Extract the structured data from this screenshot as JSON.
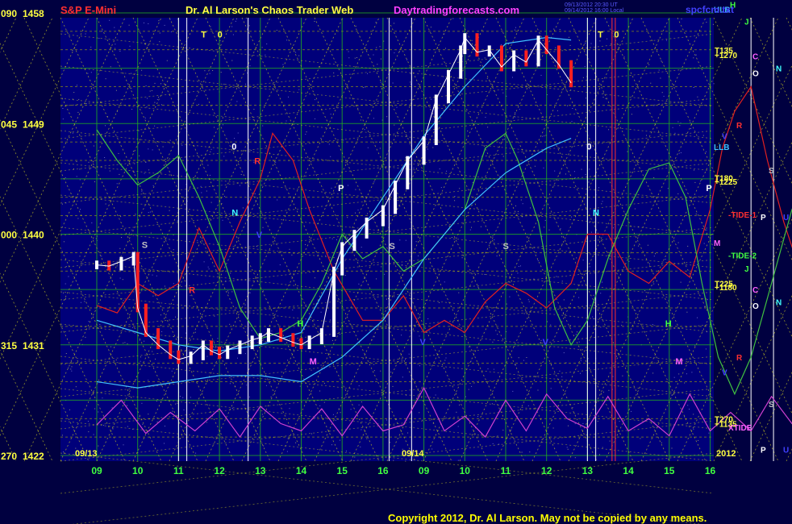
{
  "header": {
    "instrument": "S&P E-Mini",
    "title": "Dr. Al Larson's Chaos Trader Web",
    "site": "Daytradingforecasts.com",
    "file": "spcfcm.txt",
    "stamp_line1": "09/13/2012 20:30 UT",
    "stamp_line2": "09/14/2012 16:00 Local"
  },
  "copyright": "Copyright 2012, Dr. Al Larson. May not be copied by any means.",
  "colors": {
    "background": "#000040",
    "plot_background": "#00007a",
    "grid_major": "#22aa22",
    "grid_minor": "#aaaa00",
    "price_up": "#ffffff",
    "price_down": "#ff2020",
    "tide1": "#e02020",
    "tide2": "#40c040",
    "xtide": "#d040d0",
    "band": "#40c0ff",
    "vline": "#ffffff",
    "redline": "#ff3030"
  },
  "chart_data": {
    "type": "line",
    "title": "S&P E-Mini",
    "y_labels": [
      {
        "key": "090",
        "price": "1458"
      },
      {
        "key": "045",
        "price": "1449"
      },
      {
        "key": "000",
        "price": "1440"
      },
      {
        "key": "315",
        "price": "1431"
      },
      {
        "key": "270",
        "price": "1422"
      }
    ],
    "ylim": [
      1422,
      1458
    ],
    "x_ticks": [
      "09",
      "10",
      "11",
      "12",
      "13",
      "14",
      "15",
      "16",
      "09",
      "10",
      "11",
      "12",
      "13",
      "14",
      "15",
      "16"
    ],
    "dates": [
      "09/13",
      "09/14"
    ],
    "year": "2012",
    "price_series": [
      [
        0,
        1437.5
      ],
      [
        0.3,
        1437.4
      ],
      [
        0.6,
        1437.8
      ],
      [
        0.9,
        1438.2
      ],
      [
        1.0,
        1434.0
      ],
      [
        1.2,
        1432.0
      ],
      [
        1.5,
        1431.0
      ],
      [
        1.8,
        1430.2
      ],
      [
        2.0,
        1429.8
      ],
      [
        2.3,
        1430.1
      ],
      [
        2.6,
        1431.0
      ],
      [
        2.8,
        1430.5
      ],
      [
        3.0,
        1430.2
      ],
      [
        3.2,
        1430.6
      ],
      [
        3.5,
        1431.0
      ],
      [
        3.8,
        1431.4
      ],
      [
        4.0,
        1431.6
      ],
      [
        4.2,
        1432.0
      ],
      [
        4.5,
        1431.6
      ],
      [
        4.8,
        1431.2
      ],
      [
        5.0,
        1431.0
      ],
      [
        5.2,
        1431.4
      ],
      [
        5.5,
        1432.0
      ],
      [
        5.8,
        1437.0
      ],
      [
        6.0,
        1439.0
      ],
      [
        6.3,
        1440.0
      ],
      [
        6.6,
        1441.0
      ],
      [
        7.0,
        1442.0
      ],
      [
        7.3,
        1444.0
      ],
      [
        7.6,
        1446.0
      ],
      [
        8.0,
        1447.6
      ],
      [
        8.3,
        1451.0
      ],
      [
        8.6,
        1453.0
      ],
      [
        8.9,
        1455.0
      ],
      [
        9.0,
        1456.0
      ],
      [
        9.3,
        1454.8
      ],
      [
        9.6,
        1455.0
      ],
      [
        9.9,
        1453.6
      ],
      [
        10.2,
        1454.6
      ],
      [
        10.5,
        1454.0
      ],
      [
        10.8,
        1455.8
      ],
      [
        11.0,
        1455.0
      ],
      [
        11.3,
        1453.8
      ],
      [
        11.6,
        1452.3
      ]
    ],
    "series": [
      {
        "name": "TIDE-1",
        "values": [
          [
            0,
            1434.2
          ],
          [
            0.5,
            1433.6
          ],
          [
            1.0,
            1436.0
          ],
          [
            1.5,
            1435.0
          ],
          [
            2.0,
            1436.0
          ],
          [
            2.5,
            1440.5
          ],
          [
            3.0,
            1437.0
          ],
          [
            3.5,
            1441.0
          ],
          [
            4.0,
            1444.5
          ],
          [
            4.3,
            1448.2
          ],
          [
            4.8,
            1446.0
          ],
          [
            5.2,
            1442.0
          ],
          [
            5.8,
            1437.0
          ],
          [
            6.5,
            1433.0
          ],
          [
            7.0,
            1433.0
          ],
          [
            7.5,
            1435.0
          ],
          [
            8.0,
            1432.0
          ],
          [
            8.5,
            1433.0
          ],
          [
            9.0,
            1432.0
          ],
          [
            9.5,
            1434.5
          ],
          [
            10.0,
            1436.0
          ],
          [
            10.5,
            1435.2
          ],
          [
            11.0,
            1434.0
          ],
          [
            11.6,
            1436.0
          ],
          [
            12.0,
            1440.0
          ],
          [
            12.5,
            1440.0
          ],
          [
            13.0,
            1437.0
          ],
          [
            13.5,
            1436.0
          ],
          [
            14.0,
            1437.8
          ],
          [
            14.5,
            1436.5
          ],
          [
            15.0,
            1442.0
          ],
          [
            15.3,
            1447.0
          ],
          [
            15.6,
            1450.0
          ],
          [
            16.0,
            1452.0
          ],
          [
            16.4,
            1446.0
          ],
          [
            16.8,
            1441.0
          ],
          [
            17.2,
            1437.0
          ],
          [
            17.6,
            1435.0
          ],
          [
            18.0,
            1433.0
          ],
          [
            18.4,
            1432.0
          ],
          [
            18.8,
            1433.0
          ],
          [
            19.0,
            1439.0
          ],
          [
            19.2,
            1440.0
          ]
        ]
      },
      {
        "name": "TIDE-2",
        "values": [
          [
            0,
            1448.5
          ],
          [
            0.5,
            1446.0
          ],
          [
            1.0,
            1444.0
          ],
          [
            1.5,
            1445.0
          ],
          [
            2.0,
            1446.4
          ],
          [
            2.5,
            1443.0
          ],
          [
            3.0,
            1439.0
          ],
          [
            3.5,
            1434.0
          ],
          [
            4.0,
            1431.5
          ],
          [
            4.5,
            1432.0
          ],
          [
            5.0,
            1433.0
          ],
          [
            5.5,
            1436.0
          ],
          [
            6.0,
            1440.0
          ],
          [
            6.5,
            1438.0
          ],
          [
            7.0,
            1439.0
          ],
          [
            7.5,
            1437.0
          ],
          [
            8.0,
            1438.0
          ],
          [
            8.5,
            1440.0
          ],
          [
            9.0,
            1442.0
          ],
          [
            9.5,
            1447.0
          ],
          [
            10.0,
            1448.2
          ],
          [
            10.3,
            1446.0
          ],
          [
            10.8,
            1441.0
          ],
          [
            11.2,
            1434.0
          ],
          [
            11.6,
            1431.0
          ],
          [
            12.0,
            1433.0
          ],
          [
            12.5,
            1438.0
          ],
          [
            13.0,
            1442.0
          ],
          [
            13.5,
            1445.3
          ],
          [
            14.0,
            1445.8
          ],
          [
            14.4,
            1443.0
          ],
          [
            14.8,
            1436.0
          ],
          [
            15.2,
            1430.0
          ],
          [
            15.6,
            1427.0
          ],
          [
            16.0,
            1430.0
          ],
          [
            16.5,
            1436.0
          ],
          [
            17.0,
            1442.0
          ],
          [
            17.5,
            1445.4
          ],
          [
            18.0,
            1442.2
          ],
          [
            18.5,
            1441.6
          ],
          [
            19.0,
            1440.2
          ],
          [
            19.2,
            1438.0
          ]
        ]
      },
      {
        "name": "XTIDE",
        "values": [
          [
            0,
            1424.5
          ],
          [
            0.6,
            1426.5
          ],
          [
            1.2,
            1423.8
          ],
          [
            1.8,
            1425.5
          ],
          [
            2.4,
            1424.0
          ],
          [
            3.0,
            1425.8
          ],
          [
            3.5,
            1423.5
          ],
          [
            4.0,
            1426.0
          ],
          [
            4.5,
            1424.6
          ],
          [
            5.0,
            1424.0
          ],
          [
            5.5,
            1425.8
          ],
          [
            6.0,
            1423.6
          ],
          [
            6.5,
            1426.0
          ],
          [
            7.0,
            1424.0
          ],
          [
            7.5,
            1424.5
          ],
          [
            8.0,
            1427.5
          ],
          [
            8.5,
            1424.0
          ],
          [
            9.0,
            1425.2
          ],
          [
            9.5,
            1423.5
          ],
          [
            10.0,
            1426.5
          ],
          [
            10.5,
            1424.0
          ],
          [
            11.0,
            1427.0
          ],
          [
            11.5,
            1425.0
          ],
          [
            12.0,
            1424.2
          ],
          [
            12.5,
            1426.8
          ],
          [
            13.0,
            1424.0
          ],
          [
            13.5,
            1425.0
          ],
          [
            14.0,
            1423.6
          ],
          [
            14.5,
            1427.0
          ],
          [
            15.0,
            1424.0
          ],
          [
            15.5,
            1425.5
          ],
          [
            16.0,
            1424.0
          ],
          [
            16.5,
            1426.8
          ],
          [
            17.0,
            1424.6
          ],
          [
            17.5,
            1426.0
          ],
          [
            18.0,
            1424.0
          ],
          [
            18.5,
            1425.8
          ],
          [
            19.2,
            1425.0
          ]
        ]
      },
      {
        "name": "Upper Band",
        "values": [
          [
            0,
            1433.0
          ],
          [
            1,
            1432.0
          ],
          [
            2,
            1431.0
          ],
          [
            3,
            1430.5
          ],
          [
            4,
            1431.0
          ],
          [
            5,
            1432.0
          ],
          [
            6,
            1438.0
          ],
          [
            7,
            1443.0
          ],
          [
            8,
            1448.0
          ],
          [
            9,
            1452.0
          ],
          [
            10,
            1455.5
          ],
          [
            11,
            1456.0
          ],
          [
            11.6,
            1455.8
          ]
        ]
      },
      {
        "name": "Lower Band",
        "values": [
          [
            0,
            1428.0
          ],
          [
            1,
            1427.5
          ],
          [
            2,
            1428.0
          ],
          [
            3,
            1428.5
          ],
          [
            4,
            1428.5
          ],
          [
            5,
            1428.0
          ],
          [
            6,
            1430.0
          ],
          [
            7,
            1433.0
          ],
          [
            8,
            1438.0
          ],
          [
            9,
            1442.0
          ],
          [
            10,
            1445.0
          ],
          [
            11,
            1447.0
          ],
          [
            11.6,
            1447.8
          ]
        ]
      }
    ],
    "right_labels": [
      {
        "text": "M",
        "price": 1459.3,
        "color": "#ff60ff"
      },
      {
        "text": "H",
        "price": 1458.7,
        "color": "#40ff40"
      },
      {
        "text": "ULB",
        "price": 1458.3,
        "color": "#40c0ff"
      },
      {
        "text": "J",
        "price": 1457.3,
        "color": "#40ff40"
      },
      {
        "text": "T135",
        "price": 1455.0,
        "color": "#ffff40"
      },
      {
        "text": "+1270",
        "price": 1454.6,
        "color": "#ffff40"
      },
      {
        "text": "C",
        "price": 1454.5,
        "color": "#ff60ff"
      },
      {
        "text": "O",
        "price": 1453.1,
        "color": "#ffffff"
      },
      {
        "text": "N",
        "price": 1453.5,
        "color": "#40ffff"
      },
      {
        "text": "R",
        "price": 1448.9,
        "color": "#ff3030"
      },
      {
        "text": "V",
        "price": 1448.0,
        "color": "#4040ff"
      },
      {
        "text": "LLB",
        "price": 1447.1,
        "color": "#40c0ff"
      },
      {
        "text": "S",
        "price": 1445.2,
        "color": "#c0c0c0"
      },
      {
        "text": "T180",
        "price": 1444.6,
        "color": "#ffff40"
      },
      {
        "text": "+1225",
        "price": 1444.3,
        "color": "#ffff40"
      },
      {
        "text": "-TIDE-1",
        "price": 1441.6,
        "color": "#ff3030"
      },
      {
        "text": "P",
        "price": 1441.4,
        "color": "#ffffff"
      },
      {
        "text": "U",
        "price": 1441.4,
        "color": "#4040ff"
      },
      {
        "text": "M",
        "price": 1439.3,
        "color": "#ff60ff"
      },
      {
        "text": "-TIDE-2",
        "price": 1438.3,
        "color": "#40ff40"
      },
      {
        "text": "J",
        "price": 1437.2,
        "color": "#40ff40"
      },
      {
        "text": "T225",
        "price": 1436.0,
        "color": "#ffff40"
      },
      {
        "text": "+1180",
        "price": 1435.7,
        "color": "#ffff40"
      },
      {
        "text": "C",
        "price": 1435.5,
        "color": "#ff60ff"
      },
      {
        "text": "N",
        "price": 1434.5,
        "color": "#40ffff"
      },
      {
        "text": "O",
        "price": 1434.2,
        "color": "#ffffff"
      },
      {
        "text": "R",
        "price": 1430.0,
        "color": "#ff3030"
      },
      {
        "text": "V",
        "price": 1428.8,
        "color": "#4040ff"
      },
      {
        "text": "S",
        "price": 1426.2,
        "color": "#c0c0c0"
      },
      {
        "text": "T270",
        "price": 1425.0,
        "color": "#ffff40"
      },
      {
        "text": "+1135",
        "price": 1424.6,
        "color": "#ffff40"
      },
      {
        "text": "XTIDE",
        "price": 1424.3,
        "color": "#ff60ff"
      },
      {
        "text": "P",
        "price": 1422.5,
        "color": "#ffffff"
      },
      {
        "text": "U",
        "price": 1422.5,
        "color": "#4040ff"
      }
    ],
    "plot_labels": [
      {
        "text": "T",
        "x": 2.55,
        "price": 1456.0,
        "color": "#ffff40"
      },
      {
        "text": "0",
        "x": 2.95,
        "price": 1456.0,
        "color": "#ffff40"
      },
      {
        "text": "T",
        "x": 12.25,
        "price": 1456.0,
        "color": "#ffff40"
      },
      {
        "text": "0",
        "x": 12.65,
        "price": 1456.0,
        "color": "#ffff40"
      },
      {
        "text": "0",
        "x": 3.3,
        "price": 1446.9,
        "color": "#ffffff"
      },
      {
        "text": "0",
        "x": 11.98,
        "price": 1446.9,
        "color": "#ffffff"
      },
      {
        "text": "P",
        "x": 5.9,
        "price": 1443.5,
        "color": "#ffffff"
      },
      {
        "text": "P",
        "x": 14.9,
        "price": 1443.5,
        "color": "#ffffff"
      },
      {
        "text": "N",
        "x": 3.3,
        "price": 1441.5,
        "color": "#40ffff"
      },
      {
        "text": "N",
        "x": 12.13,
        "price": 1441.5,
        "color": "#40ffff"
      },
      {
        "text": "R",
        "x": 3.85,
        "price": 1445.7,
        "color": "#ff3030"
      },
      {
        "text": "R",
        "x": 2.25,
        "price": 1435.2,
        "color": "#ff3030"
      },
      {
        "text": "V",
        "x": 3.9,
        "price": 1439.7,
        "color": "#4040ff"
      },
      {
        "text": "S",
        "x": 1.1,
        "price": 1438.9,
        "color": "#c0c0c0"
      },
      {
        "text": "S",
        "x": 7.15,
        "price": 1438.8,
        "color": "#c0c0c0"
      },
      {
        "text": "S",
        "x": 9.93,
        "price": 1438.8,
        "color": "#c0c0c0"
      },
      {
        "text": "S",
        "x": 17.5,
        "price": 1438.8,
        "color": "#c0c0c0"
      },
      {
        "text": "H",
        "x": 4.9,
        "price": 1432.5,
        "color": "#40ff40"
      },
      {
        "text": "H",
        "x": 13.9,
        "price": 1432.5,
        "color": "#40ff40"
      },
      {
        "text": "M",
        "x": 5.2,
        "price": 1429.4,
        "color": "#ff60ff"
      },
      {
        "text": "M",
        "x": 14.15,
        "price": 1429.4,
        "color": "#ff60ff"
      },
      {
        "text": "V",
        "x": 7.9,
        "price": 1431.0,
        "color": "#4040ff"
      },
      {
        "text": "V",
        "x": 10.9,
        "price": 1431.0,
        "color": "#4040ff"
      }
    ],
    "vertical_lines": [
      {
        "x": 2.0,
        "color": "#ffffff"
      },
      {
        "x": 2.2,
        "color": "#ffffff"
      },
      {
        "x": 3.7,
        "color": "#ffffff"
      },
      {
        "x": 7.15,
        "color": "#ffffff"
      },
      {
        "x": 7.7,
        "color": "#ffffff"
      },
      {
        "x": 12.0,
        "color": "#ffffff"
      },
      {
        "x": 12.2,
        "color": "#ffffff"
      },
      {
        "x": 12.6,
        "color": "#ff3030"
      },
      {
        "x": 12.68,
        "color": "#ff3030"
      },
      {
        "x": 16.0,
        "color": "#ffffff"
      },
      {
        "x": 16.55,
        "color": "#ffffff"
      }
    ]
  }
}
